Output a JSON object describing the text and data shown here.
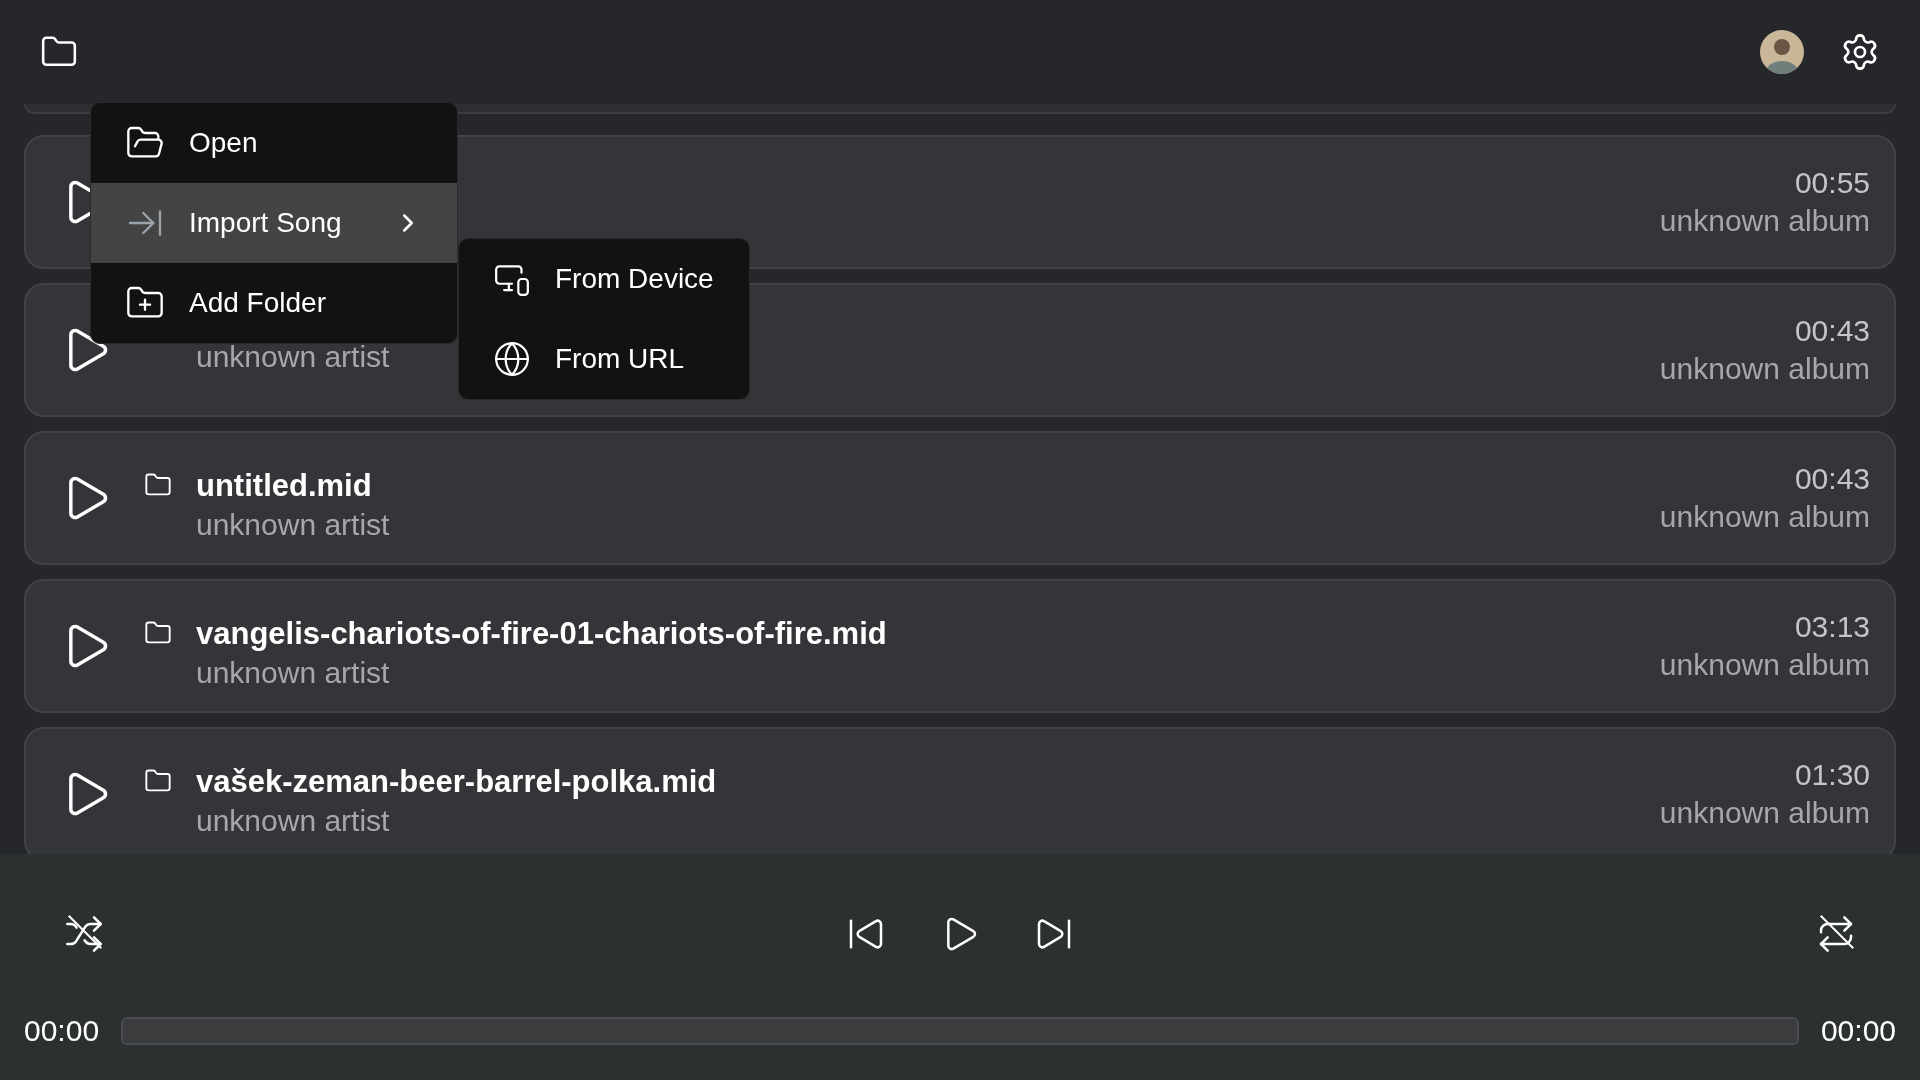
{
  "songs": [
    {
      "time": "00:55",
      "album": "unknown album"
    },
    {
      "artist": "unknown artist",
      "time": "00:43",
      "album": "unknown album"
    },
    {
      "title": "untitled.mid",
      "artist": "unknown artist",
      "time": "00:43",
      "album": "unknown album"
    },
    {
      "title": "vangelis-chariots-of-fire-01-chariots-of-fire.mid",
      "artist": "unknown artist",
      "time": "03:13",
      "album": "unknown album"
    },
    {
      "title": "vašek-zeman-beer-barrel-polka.mid",
      "artist": "unknown artist",
      "time": "01:30",
      "album": "unknown album"
    }
  ],
  "menu": {
    "items": [
      {
        "label": "Open",
        "selected": false,
        "has_submenu": false
      },
      {
        "label": "Import Song",
        "selected": true,
        "has_submenu": true
      },
      {
        "label": "Add Folder",
        "selected": false,
        "has_submenu": false
      }
    ],
    "submenu": [
      {
        "label": "From Device"
      },
      {
        "label": "From URL"
      }
    ]
  },
  "player": {
    "shuffle_on": false,
    "repeat_on": false,
    "elapsed": "00:00",
    "total": "00:00",
    "level": 0
  }
}
